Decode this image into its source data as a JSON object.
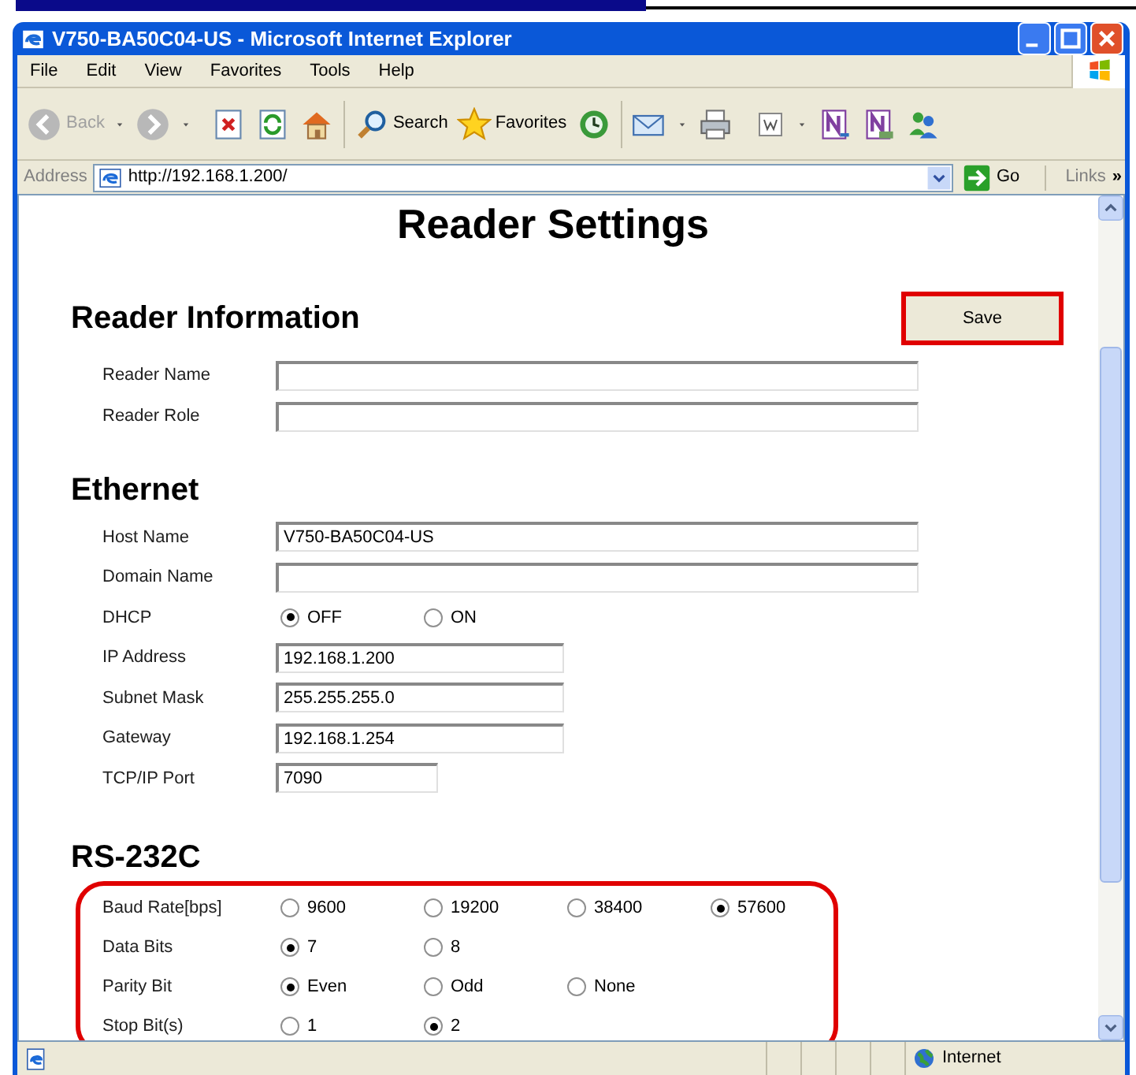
{
  "window": {
    "title": "V750-BA50C04-US - Microsoft Internet Explorer"
  },
  "menu": [
    "File",
    "Edit",
    "View",
    "Favorites",
    "Tools",
    "Help"
  ],
  "toolbar": {
    "back": {
      "label": "Back",
      "disabled": true
    },
    "forward": {
      "disabled": true
    },
    "search": {
      "label": "Search"
    },
    "favorites": {
      "label": "Favorites"
    }
  },
  "address_bar": {
    "label": "Address",
    "url": "http://192.168.1.200/",
    "go": "Go",
    "links": "Links",
    "more": "»"
  },
  "page": {
    "title": "Reader Settings",
    "save_button": {
      "label": "Save",
      "highlighted": true
    },
    "sections": [
      {
        "heading": "Reader Information",
        "highlighted": false,
        "rows": [
          {
            "label": "Reader Name",
            "kind": "text_wide",
            "value": ""
          },
          {
            "label": "Reader Role",
            "kind": "text_wide",
            "value": ""
          }
        ]
      },
      {
        "heading": "Ethernet",
        "highlighted": false,
        "rows": [
          {
            "label": "Host Name",
            "kind": "text_wide",
            "value": "V750-BA50C04-US"
          },
          {
            "label": "Domain Name",
            "kind": "text_wide",
            "value": ""
          },
          {
            "label": "DHCP",
            "kind": "radio",
            "options": [
              {
                "label": "OFF",
                "selected": true
              },
              {
                "label": "ON",
                "selected": false
              }
            ]
          },
          {
            "label": "IP Address",
            "kind": "text",
            "value": "192.168.1.200"
          },
          {
            "label": "Subnet Mask",
            "kind": "text",
            "value": "255.255.255.0"
          },
          {
            "label": "Gateway",
            "kind": "text",
            "value": "192.168.1.254"
          },
          {
            "label": "TCP/IP Port",
            "kind": "text_short",
            "value": "7090"
          }
        ]
      },
      {
        "heading": "RS-232C",
        "highlighted": true,
        "rows": [
          {
            "label": "Baud Rate[bps]",
            "kind": "radio",
            "options": [
              {
                "label": "9600",
                "selected": false
              },
              {
                "label": "19200",
                "selected": false
              },
              {
                "label": "38400",
                "selected": false
              },
              {
                "label": "57600",
                "selected": true
              }
            ]
          },
          {
            "label": "Data Bits",
            "kind": "radio",
            "options": [
              {
                "label": "7",
                "selected": true
              },
              {
                "label": "8",
                "selected": false
              }
            ]
          },
          {
            "label": "Parity Bit",
            "kind": "radio",
            "options": [
              {
                "label": "Even",
                "selected": true
              },
              {
                "label": "Odd",
                "selected": false
              },
              {
                "label": "None",
                "selected": false
              }
            ]
          },
          {
            "label": "Stop Bit(s)",
            "kind": "radio",
            "options": [
              {
                "label": "1",
                "selected": false
              },
              {
                "label": "2",
                "selected": true
              }
            ]
          }
        ]
      }
    ]
  },
  "status_bar": {
    "zone": "Internet"
  }
}
